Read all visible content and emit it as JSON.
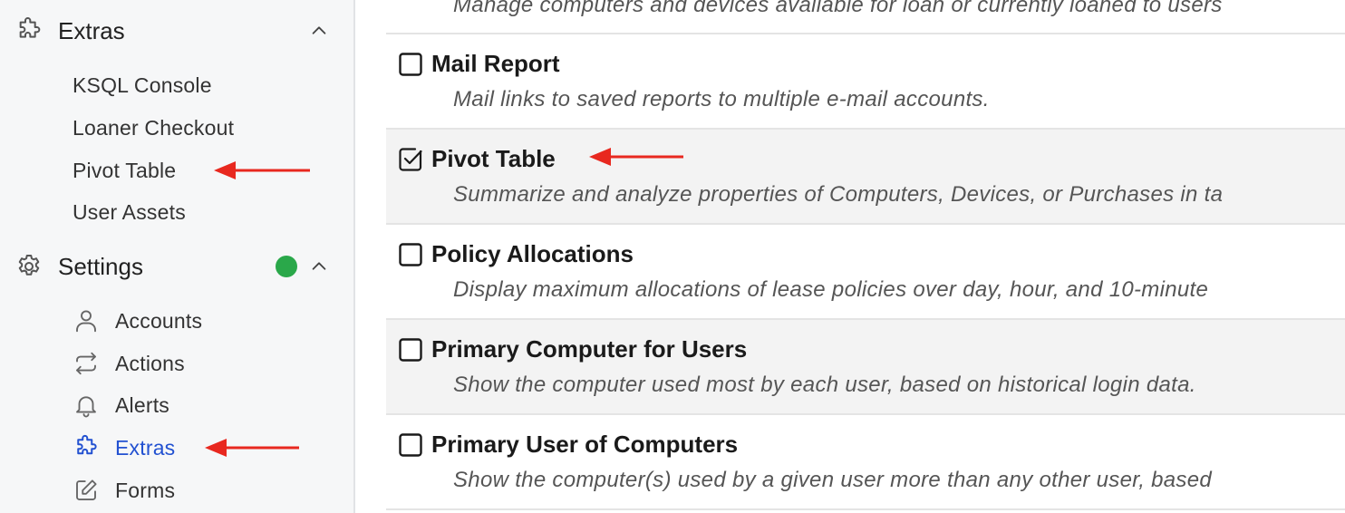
{
  "sidebar": {
    "extras_section": {
      "title": "Extras",
      "icon": "puzzle-icon",
      "items": [
        {
          "label": "KSQL Console"
        },
        {
          "label": "Loaner Checkout"
        },
        {
          "label": "Pivot Table"
        },
        {
          "label": "User Assets"
        }
      ]
    },
    "settings_section": {
      "title": "Settings",
      "icon": "gear-icon",
      "status_color": "#2aa84a",
      "items": [
        {
          "label": "Accounts",
          "icon": "user-icon"
        },
        {
          "label": "Actions",
          "icon": "repeat-icon"
        },
        {
          "label": "Alerts",
          "icon": "bell-icon"
        },
        {
          "label": "Extras",
          "icon": "puzzle-icon",
          "active": true
        },
        {
          "label": "Forms",
          "icon": "edit-icon"
        }
      ]
    }
  },
  "extras_list": [
    {
      "name": "",
      "description": "Manage computers and devices available for loan or currently loaned to users",
      "checked": false
    },
    {
      "name": "Mail Report",
      "description": "Mail links to saved reports to multiple e-mail accounts.",
      "checked": false
    },
    {
      "name": "Pivot Table",
      "description": "Summarize and analyze properties of Computers, Devices, or Purchases in ta",
      "checked": true
    },
    {
      "name": "Policy Allocations",
      "description": "Display maximum allocations of lease policies over day, hour, and 10-minute",
      "checked": false
    },
    {
      "name": "Primary Computer for Users",
      "description": "Show the computer used most by each user, based on historical login data.",
      "checked": false
    },
    {
      "name": "Primary User of Computers",
      "description": "Show the computer(s) used by a given user more than any other user, based",
      "checked": false
    }
  ],
  "colors": {
    "accent": "#2251d1",
    "annotation_arrow": "#e8281f",
    "status_dot": "#2aa84a"
  }
}
